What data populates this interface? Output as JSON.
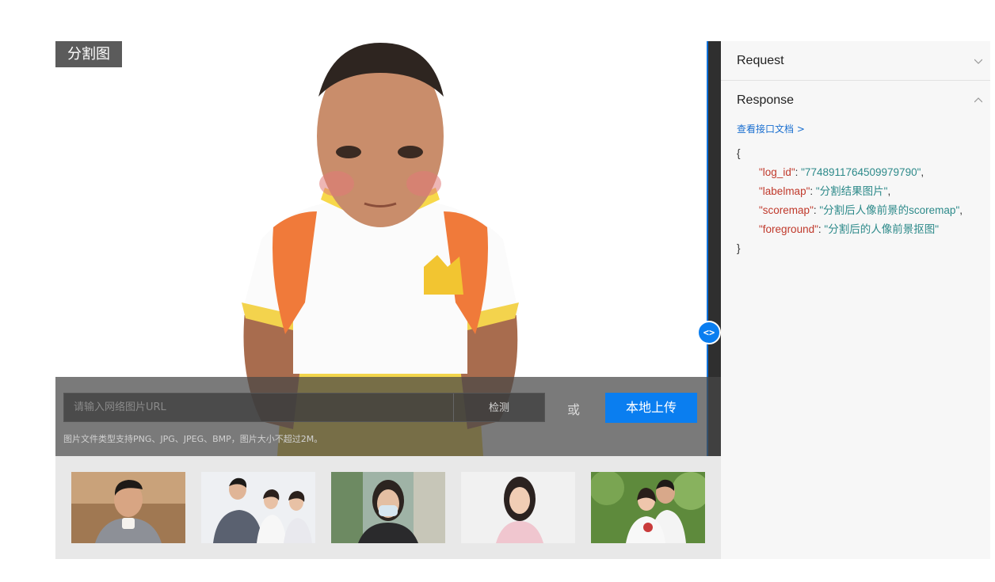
{
  "demo": {
    "tag_label": "分割图",
    "url_placeholder": "请输入网络图片URL",
    "detect_label": "检测",
    "or_label": "或",
    "upload_label": "本地上传",
    "hint": "图片文件类型支持PNG、JPG、JPEG、BMP，图片大小不超过2M。"
  },
  "thumbnails": [
    {
      "name": "thumbnail-man-coffee"
    },
    {
      "name": "thumbnail-business-group"
    },
    {
      "name": "thumbnail-woman-mask"
    },
    {
      "name": "thumbnail-woman-smiling"
    },
    {
      "name": "thumbnail-couple-outdoor"
    }
  ],
  "panel": {
    "request_label": "Request",
    "response_label": "Response",
    "doc_link": "查看接口文档 >",
    "json_open": "{",
    "json_close": "}",
    "fields": [
      {
        "key": "\"log_id\"",
        "value": "\"7748911764509979790\""
      },
      {
        "key": "\"labelmap\"",
        "value": "\"分割结果图片\""
      },
      {
        "key": "\"scoremap\"",
        "value": "\"分割后人像前景的scoremap\""
      },
      {
        "key": "\"foreground\"",
        "value": "\"分割后的人像前景抠图\""
      }
    ]
  },
  "colors": {
    "accent": "#0a7ef0",
    "json_key": "#c0392b",
    "json_value": "#2d8a8a"
  },
  "icons": {
    "toggle": "code-toggle-icon",
    "request_chevron": "chevron-down-icon",
    "response_chevron": "chevron-up-icon"
  }
}
